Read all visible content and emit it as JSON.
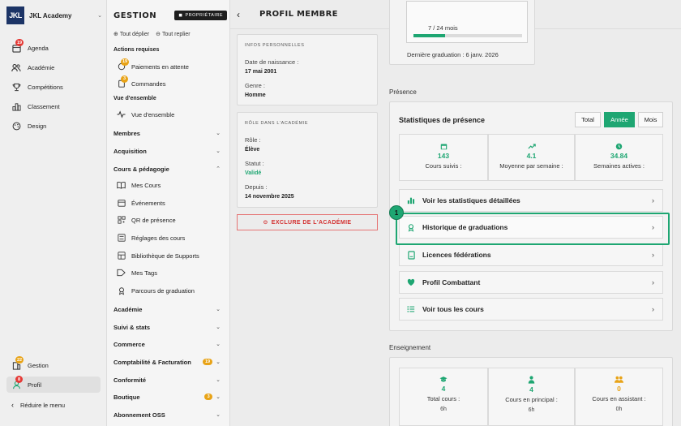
{
  "brand": {
    "name": "JKL Academy",
    "logo_text": "JKL"
  },
  "left_nav": [
    {
      "label": "Agenda",
      "icon": "calendar-icon",
      "badge": "19"
    },
    {
      "label": "Académie",
      "icon": "users-icon"
    },
    {
      "label": "Compétitions",
      "icon": "trophy-icon"
    },
    {
      "label": "Classement",
      "icon": "ranking-icon"
    },
    {
      "label": "Design",
      "icon": "palette-icon"
    }
  ],
  "left_bottom": [
    {
      "label": "Gestion",
      "icon": "building-icon",
      "badge": "22"
    },
    {
      "label": "Profil",
      "icon": "user-icon",
      "badge": "8"
    }
  ],
  "reduce_label": "Réduire le menu",
  "gestion": {
    "title": "GESTION",
    "owner_label": "PROPRIÉTAIRE",
    "expand_all": "Tout déplier",
    "collapse_all": "Tout replier",
    "actions_header": "Actions requises",
    "actions": [
      {
        "label": "Paiements en attente",
        "badge": "19"
      },
      {
        "label": "Commandes",
        "badge": "3"
      }
    ],
    "overview_header": "Vue d'ensemble",
    "overview_item": "Vue d'ensemble",
    "groups_top": [
      "Membres",
      "Acquisition"
    ],
    "cours_group": "Cours & pédagogie",
    "cours_items": [
      "Mes Cours",
      "Événements",
      "QR de présence",
      "Réglages des cours",
      "Bibliothèque de Supports",
      "Mes Tags",
      "Parcours de graduation"
    ],
    "groups_bottom": [
      {
        "label": "Académie"
      },
      {
        "label": "Suivi & stats"
      },
      {
        "label": "Commerce"
      },
      {
        "label": "Comptabilité & Facturation",
        "badge": "19"
      },
      {
        "label": "Conformité"
      },
      {
        "label": "Boutique",
        "badge": "3"
      },
      {
        "label": "Abonnement OSS"
      }
    ]
  },
  "page": {
    "title": "PROFIL MEMBRE"
  },
  "personal": {
    "caption": "INFOS PERSONNELLES",
    "birth_label": "Date de naissance :",
    "birth_value": "17 mai 2001",
    "gender_label": "Genre :",
    "gender_value": "Homme"
  },
  "role": {
    "caption": "RÔLE DANS L'ACADÉMIE",
    "role_label": "Rôle :",
    "role_value": "Élève",
    "status_label": "Statut :",
    "status_value": "Validé",
    "since_label": "Depuis :",
    "since_value": "14 novembre 2025"
  },
  "exclude_label": "EXCLURE DE L'ACADÉMIE",
  "graduation": {
    "progress_text": "7 / 24 mois",
    "progress": 0.29,
    "last_label": "Dernière graduation : 6 janv. 2026"
  },
  "presence": {
    "section": "Présence",
    "title": "Statistiques de présence",
    "toggles": [
      "Total",
      "Année",
      "Mois"
    ],
    "active_toggle": "Année",
    "stats": [
      {
        "value": "143",
        "label": "Cours suivis :",
        "icon": "calendar-icon"
      },
      {
        "value": "4.1",
        "label": "Moyenne par semaine :",
        "icon": "trend-up-icon"
      },
      {
        "value": "34.84",
        "label": "Semaines actives :",
        "icon": "clock-icon"
      }
    ],
    "rows": [
      {
        "label": "Voir les statistiques détaillées",
        "icon": "bar-chart-icon"
      },
      {
        "label": "Historique de graduations",
        "icon": "medal-icon"
      },
      {
        "label": "Licences fédérations",
        "icon": "id-card-icon"
      },
      {
        "label": "Profil Combattant",
        "icon": "heart-shield-icon"
      },
      {
        "label": "Voir tous les cours",
        "icon": "list-icon"
      }
    ],
    "highlight_number": "1"
  },
  "teaching": {
    "section": "Enseignement",
    "stats": [
      {
        "value": "4",
        "label": "Total cours :",
        "sub": "6h",
        "icon": "graduation-cap-icon"
      },
      {
        "value": "4",
        "label": "Cours en principal :",
        "sub": "6h",
        "icon": "person-icon"
      },
      {
        "value": "0",
        "label": "Cours en assistant :",
        "sub": "0h",
        "icon": "people-icon"
      }
    ]
  },
  "colors": {
    "accent": "#1ea672",
    "danger": "#d32f2f",
    "brand": "#1c3466"
  }
}
